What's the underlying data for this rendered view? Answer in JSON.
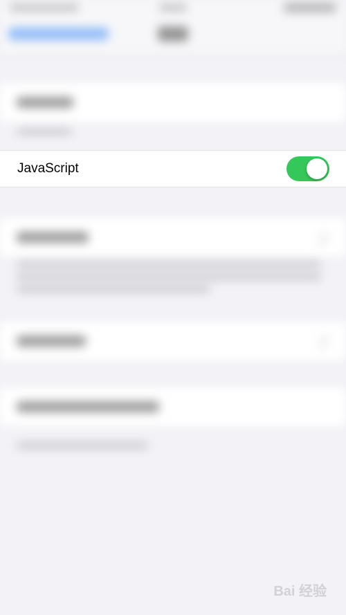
{
  "setting": {
    "label": "JavaScript",
    "enabled": true
  },
  "colors": {
    "toggle_on": "#34c759",
    "background": "#f2f2f7",
    "cell": "#ffffff"
  },
  "watermark": "Bai 经验"
}
